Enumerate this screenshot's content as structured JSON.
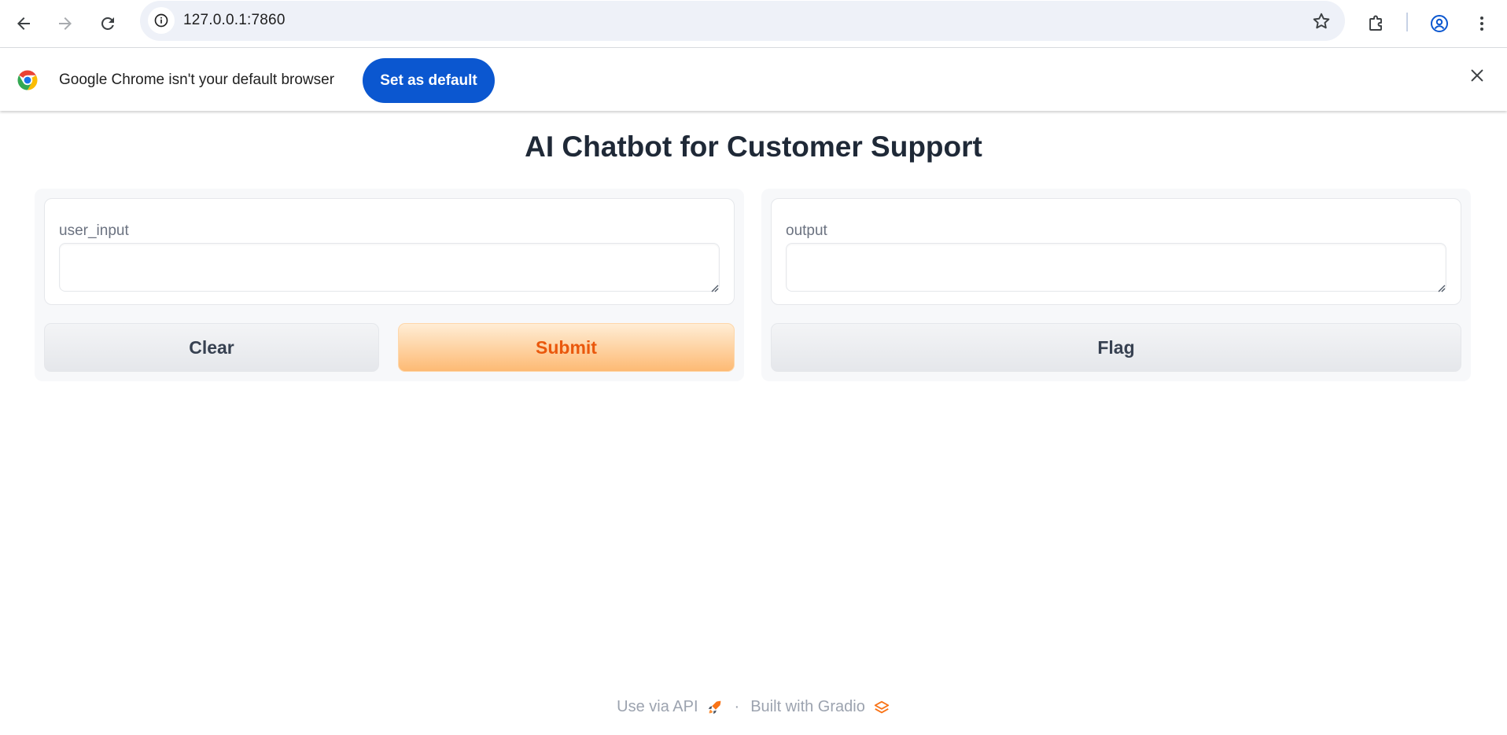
{
  "browser": {
    "url": "127.0.0.1:7860",
    "infobar": {
      "message": "Google Chrome isn't your default browser",
      "action_label": "Set as default"
    }
  },
  "app": {
    "title": "AI Chatbot for Customer Support",
    "input": {
      "label": "user_input",
      "value": ""
    },
    "output": {
      "label": "output",
      "value": ""
    },
    "buttons": {
      "clear": "Clear",
      "submit": "Submit",
      "flag": "Flag"
    }
  },
  "footer": {
    "api_link": "Use via API",
    "separator": "·",
    "built_with": "Built with Gradio"
  },
  "icons": {
    "back": "arrow-left-icon",
    "forward": "arrow-right-icon",
    "reload": "reload-icon",
    "site_info": "info-icon",
    "bookmark": "star-icon",
    "extensions": "puzzle-icon",
    "profile": "account-icon",
    "menu": "kebab-menu-icon",
    "close": "close-icon",
    "api": "rocket-icon",
    "gradio": "gradio-logo-icon"
  },
  "colors": {
    "primary_button_text": "#ea580c",
    "infobar_button": "#0b57d0",
    "profile_icon": "#0b57d0"
  }
}
